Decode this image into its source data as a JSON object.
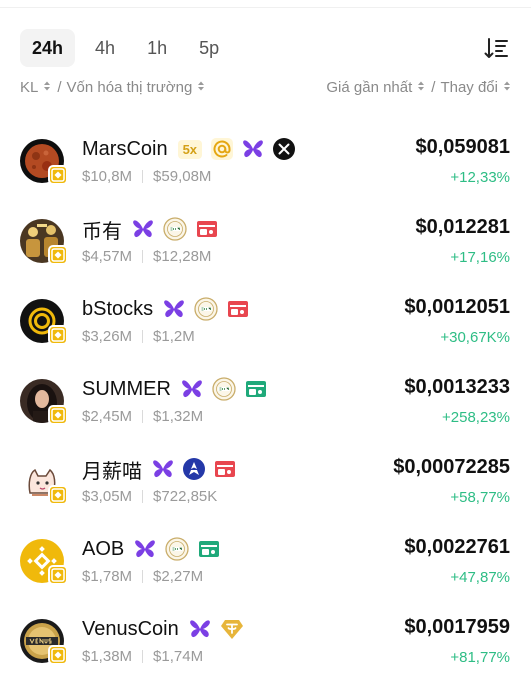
{
  "tabs": [
    {
      "label": "24h",
      "active": true
    },
    {
      "label": "4h",
      "active": false
    },
    {
      "label": "1h",
      "active": false
    },
    {
      "label": "5p",
      "active": false
    }
  ],
  "header": {
    "left_col1": "KL",
    "left_sep": "/",
    "left_col2": "Vốn hóa thị trường",
    "right_col1": "Giá gần nhất",
    "right_sep": "/",
    "right_col2": "Thay đổi"
  },
  "colors": {
    "positive": "#2ebd85",
    "accent_gold": "#f0b90b",
    "tag_purple": "#7b3fe4",
    "tag_red": "#e8464f",
    "tag_green": "#1fa97a"
  },
  "tokens": [
    {
      "name": "MarsCoin",
      "volume": "$10,8M",
      "mcap": "$59,08M",
      "price": "$0,059081",
      "change": "+12,33%",
      "leverage": "5x",
      "tags": [
        "at-sign-icon",
        "butterfly-icon",
        "x-logo-icon"
      ],
      "avatar": "mars"
    },
    {
      "name": "币有",
      "volume": "$4,57M",
      "mcap": "$12,28M",
      "price": "$0,012281",
      "change": "+17,16%",
      "leverage": "",
      "tags": [
        "butterfly-icon",
        "spdr-icon",
        "wallet-red-icon"
      ],
      "avatar": "biyou"
    },
    {
      "name": "bStocks",
      "volume": "$3,26M",
      "mcap": "$1,2M",
      "price": "$0,0012051",
      "change": "+30,67K%",
      "leverage": "",
      "tags": [
        "butterfly-icon",
        "spdr-icon",
        "wallet-red-icon"
      ],
      "avatar": "bstocks"
    },
    {
      "name": "SUMMER",
      "volume": "$2,45M",
      "mcap": "$1,32M",
      "price": "$0,0013233",
      "change": "+258,23%",
      "leverage": "",
      "tags": [
        "butterfly-icon",
        "spdr-icon",
        "wallet-green-icon"
      ],
      "avatar": "summer"
    },
    {
      "name": "月薪喵",
      "volume": "$3,05M",
      "mcap": "$722,85K",
      "price": "$0,00072285",
      "change": "+58,77%",
      "leverage": "",
      "tags": [
        "butterfly-icon",
        "rocket-icon",
        "wallet-red-icon"
      ],
      "avatar": "cat"
    },
    {
      "name": "AOB",
      "volume": "$1,78M",
      "mcap": "$2,27M",
      "price": "$0,0022761",
      "change": "+47,87%",
      "leverage": "",
      "tags": [
        "butterfly-icon",
        "spdr-icon",
        "wallet-green-icon"
      ],
      "avatar": "aob"
    },
    {
      "name": "VenusCoin",
      "volume": "$1,38M",
      "mcap": "$1,74M",
      "price": "$0,0017959",
      "change": "+81,77%",
      "leverage": "",
      "tags": [
        "butterfly-icon",
        "tether-gold-icon"
      ],
      "avatar": "venus"
    }
  ]
}
